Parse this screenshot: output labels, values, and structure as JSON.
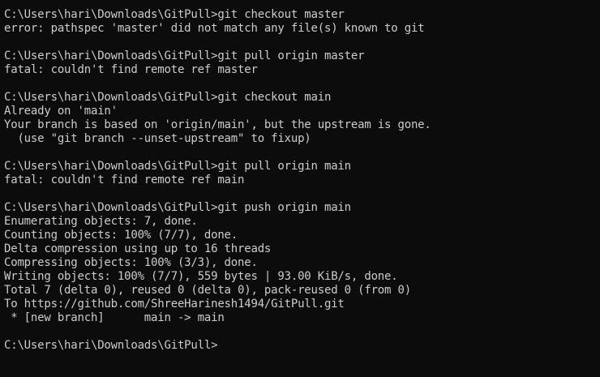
{
  "terminal": {
    "lines": [
      "C:\\Users\\hari\\Downloads\\GitPull>git checkout master",
      "error: pathspec 'master' did not match any file(s) known to git",
      "",
      "C:\\Users\\hari\\Downloads\\GitPull>git pull origin master",
      "fatal: couldn't find remote ref master",
      "",
      "C:\\Users\\hari\\Downloads\\GitPull>git checkout main",
      "Already on 'main'",
      "Your branch is based on 'origin/main', but the upstream is gone.",
      "  (use \"git branch --unset-upstream\" to fixup)",
      "",
      "C:\\Users\\hari\\Downloads\\GitPull>git pull origin main",
      "fatal: couldn't find remote ref main",
      "",
      "C:\\Users\\hari\\Downloads\\GitPull>git push origin main",
      "Enumerating objects: 7, done.",
      "Counting objects: 100% (7/7), done.",
      "Delta compression using up to 16 threads",
      "Compressing objects: 100% (3/3), done.",
      "Writing objects: 100% (7/7), 559 bytes | 93.00 KiB/s, done.",
      "Total 7 (delta 0), reused 0 (delta 0), pack-reused 0 (from 0)",
      "To https://github.com/ShreeHarinesh1494/GitPull.git",
      " * [new branch]      main -> main",
      "",
      "C:\\Users\\hari\\Downloads\\GitPull>"
    ],
    "colors": {
      "background": "#0c0c0c",
      "foreground": "#cccccc"
    }
  }
}
